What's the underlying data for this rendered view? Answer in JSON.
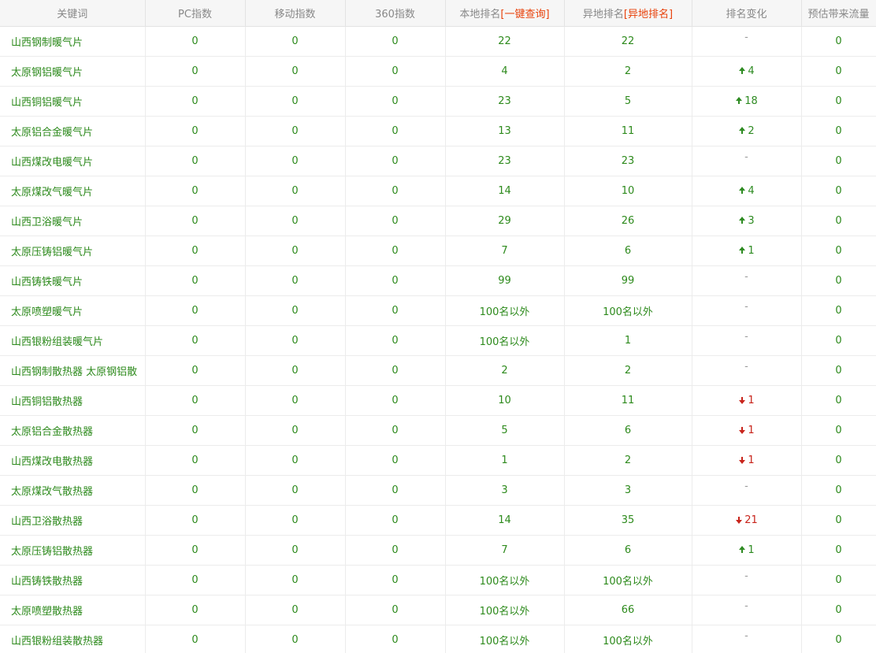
{
  "table": {
    "headers": {
      "keyword": "关键词",
      "pc_index": "PC指数",
      "mobile_index": "移动指数",
      "index_360": "360指数",
      "local_rank_prefix": "本地排名",
      "local_rank_link": "[一键查询]",
      "remote_rank_prefix": "异地排名",
      "remote_rank_link": "[异地排名]",
      "rank_change": "排名变化",
      "traffic": "预估带来流量"
    },
    "rows": [
      {
        "keyword": "山西钢制暖气片",
        "pc": "0",
        "mobile": "0",
        "i360": "0",
        "local": "22",
        "remote": "22",
        "dir": "none",
        "change": "-",
        "traffic": "0"
      },
      {
        "keyword": "太原钢铝暖气片",
        "pc": "0",
        "mobile": "0",
        "i360": "0",
        "local": "4",
        "remote": "2",
        "dir": "up",
        "change": "4",
        "traffic": "0"
      },
      {
        "keyword": "山西铜铝暖气片",
        "pc": "0",
        "mobile": "0",
        "i360": "0",
        "local": "23",
        "remote": "5",
        "dir": "up",
        "change": "18",
        "traffic": "0"
      },
      {
        "keyword": "太原铝合金暖气片",
        "pc": "0",
        "mobile": "0",
        "i360": "0",
        "local": "13",
        "remote": "11",
        "dir": "up",
        "change": "2",
        "traffic": "0"
      },
      {
        "keyword": "山西煤改电暖气片",
        "pc": "0",
        "mobile": "0",
        "i360": "0",
        "local": "23",
        "remote": "23",
        "dir": "none",
        "change": "-",
        "traffic": "0"
      },
      {
        "keyword": "太原煤改气暖气片",
        "pc": "0",
        "mobile": "0",
        "i360": "0",
        "local": "14",
        "remote": "10",
        "dir": "up",
        "change": "4",
        "traffic": "0"
      },
      {
        "keyword": "山西卫浴暖气片",
        "pc": "0",
        "mobile": "0",
        "i360": "0",
        "local": "29",
        "remote": "26",
        "dir": "up",
        "change": "3",
        "traffic": "0"
      },
      {
        "keyword": "太原压铸铝暖气片",
        "pc": "0",
        "mobile": "0",
        "i360": "0",
        "local": "7",
        "remote": "6",
        "dir": "up",
        "change": "1",
        "traffic": "0"
      },
      {
        "keyword": "山西铸铁暖气片",
        "pc": "0",
        "mobile": "0",
        "i360": "0",
        "local": "99",
        "remote": "99",
        "dir": "none",
        "change": "-",
        "traffic": "0"
      },
      {
        "keyword": "太原喷塑暖气片",
        "pc": "0",
        "mobile": "0",
        "i360": "0",
        "local": "100名以外",
        "remote": "100名以外",
        "dir": "none",
        "change": "-",
        "traffic": "0"
      },
      {
        "keyword": "山西银粉组装暖气片",
        "pc": "0",
        "mobile": "0",
        "i360": "0",
        "local": "100名以外",
        "remote": "1",
        "dir": "none",
        "change": "-",
        "traffic": "0"
      },
      {
        "keyword": "山西钢制散热器 太原钢铝散",
        "pc": "0",
        "mobile": "0",
        "i360": "0",
        "local": "2",
        "remote": "2",
        "dir": "none",
        "change": "-",
        "traffic": "0"
      },
      {
        "keyword": "山西铜铝散热器",
        "pc": "0",
        "mobile": "0",
        "i360": "0",
        "local": "10",
        "remote": "11",
        "dir": "down",
        "change": "1",
        "traffic": "0"
      },
      {
        "keyword": "太原铝合金散热器",
        "pc": "0",
        "mobile": "0",
        "i360": "0",
        "local": "5",
        "remote": "6",
        "dir": "down",
        "change": "1",
        "traffic": "0"
      },
      {
        "keyword": "山西煤改电散热器",
        "pc": "0",
        "mobile": "0",
        "i360": "0",
        "local": "1",
        "remote": "2",
        "dir": "down",
        "change": "1",
        "traffic": "0"
      },
      {
        "keyword": "太原煤改气散热器",
        "pc": "0",
        "mobile": "0",
        "i360": "0",
        "local": "3",
        "remote": "3",
        "dir": "none",
        "change": "-",
        "traffic": "0"
      },
      {
        "keyword": "山西卫浴散热器",
        "pc": "0",
        "mobile": "0",
        "i360": "0",
        "local": "14",
        "remote": "35",
        "dir": "down",
        "change": "21",
        "traffic": "0"
      },
      {
        "keyword": "太原压铸铝散热器",
        "pc": "0",
        "mobile": "0",
        "i360": "0",
        "local": "7",
        "remote": "6",
        "dir": "up",
        "change": "1",
        "traffic": "0"
      },
      {
        "keyword": "山西铸铁散热器",
        "pc": "0",
        "mobile": "0",
        "i360": "0",
        "local": "100名以外",
        "remote": "100名以外",
        "dir": "none",
        "change": "-",
        "traffic": "0"
      },
      {
        "keyword": "太原喷塑散热器",
        "pc": "0",
        "mobile": "0",
        "i360": "0",
        "local": "100名以外",
        "remote": "66",
        "dir": "none",
        "change": "-",
        "traffic": "0"
      },
      {
        "keyword": "山西银粉组装散热器",
        "pc": "0",
        "mobile": "0",
        "i360": "0",
        "local": "100名以外",
        "remote": "100名以外",
        "dir": "none",
        "change": "-",
        "traffic": "0"
      }
    ]
  },
  "colors": {
    "text_green": "#2d8a1c",
    "header_text": "#888888",
    "header_link": "#e8410a",
    "up": "#2e8b22",
    "down": "#c8241b"
  }
}
